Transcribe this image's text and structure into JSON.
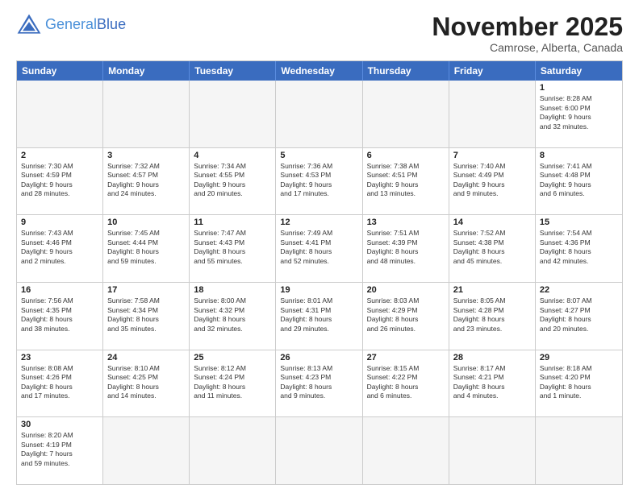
{
  "header": {
    "logo_general": "General",
    "logo_blue": "Blue",
    "month_title": "November 2025",
    "location": "Camrose, Alberta, Canada"
  },
  "weekdays": [
    "Sunday",
    "Monday",
    "Tuesday",
    "Wednesday",
    "Thursday",
    "Friday",
    "Saturday"
  ],
  "rows": [
    [
      {
        "day": "",
        "info": "",
        "empty": true
      },
      {
        "day": "",
        "info": "",
        "empty": true
      },
      {
        "day": "",
        "info": "",
        "empty": true
      },
      {
        "day": "",
        "info": "",
        "empty": true
      },
      {
        "day": "",
        "info": "",
        "empty": true
      },
      {
        "day": "",
        "info": "",
        "empty": true
      },
      {
        "day": "1",
        "info": "Sunrise: 8:28 AM\nSunset: 6:00 PM\nDaylight: 9 hours\nand 32 minutes.",
        "empty": false
      }
    ],
    [
      {
        "day": "2",
        "info": "Sunrise: 7:30 AM\nSunset: 4:59 PM\nDaylight: 9 hours\nand 28 minutes.",
        "empty": false
      },
      {
        "day": "3",
        "info": "Sunrise: 7:32 AM\nSunset: 4:57 PM\nDaylight: 9 hours\nand 24 minutes.",
        "empty": false
      },
      {
        "day": "4",
        "info": "Sunrise: 7:34 AM\nSunset: 4:55 PM\nDaylight: 9 hours\nand 20 minutes.",
        "empty": false
      },
      {
        "day": "5",
        "info": "Sunrise: 7:36 AM\nSunset: 4:53 PM\nDaylight: 9 hours\nand 17 minutes.",
        "empty": false
      },
      {
        "day": "6",
        "info": "Sunrise: 7:38 AM\nSunset: 4:51 PM\nDaylight: 9 hours\nand 13 minutes.",
        "empty": false
      },
      {
        "day": "7",
        "info": "Sunrise: 7:40 AM\nSunset: 4:49 PM\nDaylight: 9 hours\nand 9 minutes.",
        "empty": false
      },
      {
        "day": "8",
        "info": "Sunrise: 7:41 AM\nSunset: 4:48 PM\nDaylight: 9 hours\nand 6 minutes.",
        "empty": false
      }
    ],
    [
      {
        "day": "9",
        "info": "Sunrise: 7:43 AM\nSunset: 4:46 PM\nDaylight: 9 hours\nand 2 minutes.",
        "empty": false
      },
      {
        "day": "10",
        "info": "Sunrise: 7:45 AM\nSunset: 4:44 PM\nDaylight: 8 hours\nand 59 minutes.",
        "empty": false
      },
      {
        "day": "11",
        "info": "Sunrise: 7:47 AM\nSunset: 4:43 PM\nDaylight: 8 hours\nand 55 minutes.",
        "empty": false
      },
      {
        "day": "12",
        "info": "Sunrise: 7:49 AM\nSunset: 4:41 PM\nDaylight: 8 hours\nand 52 minutes.",
        "empty": false
      },
      {
        "day": "13",
        "info": "Sunrise: 7:51 AM\nSunset: 4:39 PM\nDaylight: 8 hours\nand 48 minutes.",
        "empty": false
      },
      {
        "day": "14",
        "info": "Sunrise: 7:52 AM\nSunset: 4:38 PM\nDaylight: 8 hours\nand 45 minutes.",
        "empty": false
      },
      {
        "day": "15",
        "info": "Sunrise: 7:54 AM\nSunset: 4:36 PM\nDaylight: 8 hours\nand 42 minutes.",
        "empty": false
      }
    ],
    [
      {
        "day": "16",
        "info": "Sunrise: 7:56 AM\nSunset: 4:35 PM\nDaylight: 8 hours\nand 38 minutes.",
        "empty": false
      },
      {
        "day": "17",
        "info": "Sunrise: 7:58 AM\nSunset: 4:34 PM\nDaylight: 8 hours\nand 35 minutes.",
        "empty": false
      },
      {
        "day": "18",
        "info": "Sunrise: 8:00 AM\nSunset: 4:32 PM\nDaylight: 8 hours\nand 32 minutes.",
        "empty": false
      },
      {
        "day": "19",
        "info": "Sunrise: 8:01 AM\nSunset: 4:31 PM\nDaylight: 8 hours\nand 29 minutes.",
        "empty": false
      },
      {
        "day": "20",
        "info": "Sunrise: 8:03 AM\nSunset: 4:29 PM\nDaylight: 8 hours\nand 26 minutes.",
        "empty": false
      },
      {
        "day": "21",
        "info": "Sunrise: 8:05 AM\nSunset: 4:28 PM\nDaylight: 8 hours\nand 23 minutes.",
        "empty": false
      },
      {
        "day": "22",
        "info": "Sunrise: 8:07 AM\nSunset: 4:27 PM\nDaylight: 8 hours\nand 20 minutes.",
        "empty": false
      }
    ],
    [
      {
        "day": "23",
        "info": "Sunrise: 8:08 AM\nSunset: 4:26 PM\nDaylight: 8 hours\nand 17 minutes.",
        "empty": false
      },
      {
        "day": "24",
        "info": "Sunrise: 8:10 AM\nSunset: 4:25 PM\nDaylight: 8 hours\nand 14 minutes.",
        "empty": false
      },
      {
        "day": "25",
        "info": "Sunrise: 8:12 AM\nSunset: 4:24 PM\nDaylight: 8 hours\nand 11 minutes.",
        "empty": false
      },
      {
        "day": "26",
        "info": "Sunrise: 8:13 AM\nSunset: 4:23 PM\nDaylight: 8 hours\nand 9 minutes.",
        "empty": false
      },
      {
        "day": "27",
        "info": "Sunrise: 8:15 AM\nSunset: 4:22 PM\nDaylight: 8 hours\nand 6 minutes.",
        "empty": false
      },
      {
        "day": "28",
        "info": "Sunrise: 8:17 AM\nSunset: 4:21 PM\nDaylight: 8 hours\nand 4 minutes.",
        "empty": false
      },
      {
        "day": "29",
        "info": "Sunrise: 8:18 AM\nSunset: 4:20 PM\nDaylight: 8 hours\nand 1 minute.",
        "empty": false
      }
    ],
    [
      {
        "day": "30",
        "info": "Sunrise: 8:20 AM\nSunset: 4:19 PM\nDaylight: 7 hours\nand 59 minutes.",
        "empty": false
      },
      {
        "day": "",
        "info": "",
        "empty": true
      },
      {
        "day": "",
        "info": "",
        "empty": true
      },
      {
        "day": "",
        "info": "",
        "empty": true
      },
      {
        "day": "",
        "info": "",
        "empty": true
      },
      {
        "day": "",
        "info": "",
        "empty": true
      },
      {
        "day": "",
        "info": "",
        "empty": true
      }
    ]
  ]
}
